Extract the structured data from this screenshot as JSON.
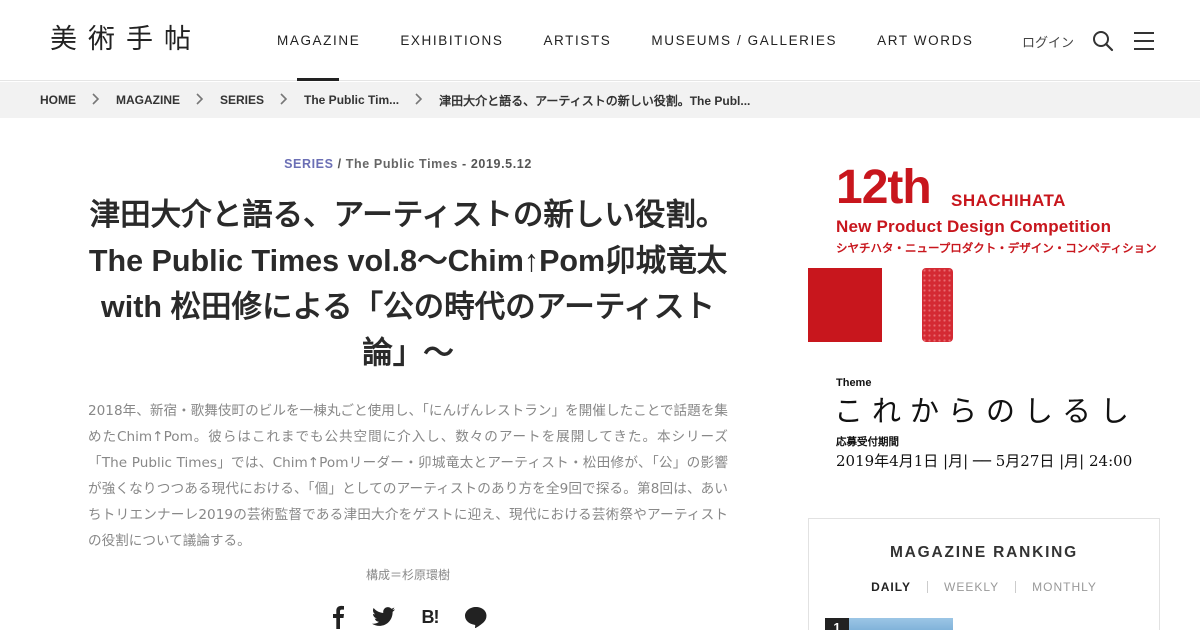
{
  "header": {
    "logo": "美術手帖",
    "nav": [
      {
        "label": "MAGAZINE",
        "active": true
      },
      {
        "label": "EXHIBITIONS",
        "active": false
      },
      {
        "label": "ARTISTS",
        "active": false
      },
      {
        "label": "MUSEUMS / GALLERIES",
        "active": false
      },
      {
        "label": "ART WORDS",
        "active": false
      }
    ],
    "login": "ログイン",
    "search_icon": "search-icon",
    "menu_icon": "hamburger-icon"
  },
  "breadcrumb": [
    "HOME",
    "MAGAZINE",
    "SERIES",
    "The Public Tim...",
    "津田大介と語る、アーティストの新しい役割。The Publ..."
  ],
  "article": {
    "category": "SERIES",
    "separator": "/",
    "subcategory": "The Public Times",
    "date": "- 2019.5.12",
    "title": "津田大介と語る、アーティストの新しい役割。The Public Times vol.8〜Chim↑Pom卯城竜太 with 松田修による「公の時代のアーティスト論」〜",
    "lead": "2018年、新宿・歌舞伎町のビルを一棟丸ごと使用し、「にんげんレストラン」を開催したことで話題を集めたChim↑Pom。彼らはこれまでも公共空間に介入し、数々のアートを展開してきた。本シリーズ「The Public Times」では、Chim↑Pomリーダー・卯城竜太とアーティスト・松田修が、「公」の影響が強くなりつつある現代における、「個」としてのアーティストのあり方を全9回で探る。第8回は、あいちトリエンナーレ2019の芸術監督である津田大介をゲストに迎え、現代における芸術祭やアーティストの役割について議論する。",
    "credit": "構成＝杉原環樹",
    "share": [
      "facebook-icon",
      "twitter-icon",
      "hatena-bookmark-icon",
      "line-icon"
    ],
    "share_line_label": "LINE",
    "share_hatena_label": "B!"
  },
  "ad": {
    "number": "12th",
    "brand": "SHACHIHATA",
    "competition": "New Product Design Competition",
    "competition_jp": "シヤチハタ・ニュープロダクト・デザイン・コンペティション",
    "theme_label": "Theme",
    "theme": "これからのしるし",
    "period_label": "応募受付期間",
    "period": "2019年4月1日 |月| ── 5月27日 |月| 24:00",
    "accent_color": "#c8161d"
  },
  "ranking": {
    "title": "MAGAZINE RANKING",
    "tabs": [
      {
        "label": "DAILY",
        "active": true
      },
      {
        "label": "WEEKLY",
        "active": false
      },
      {
        "label": "MONTHLY",
        "active": false
      }
    ],
    "first_rank": "1"
  }
}
